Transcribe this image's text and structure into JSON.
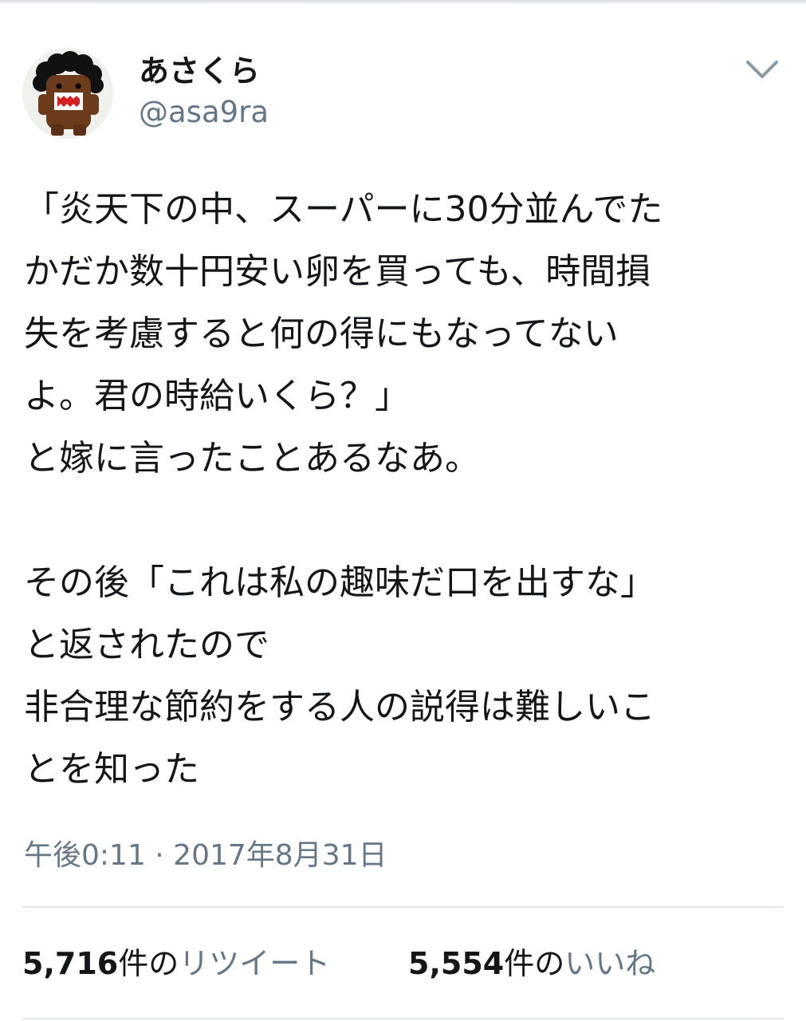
{
  "author": {
    "display_name": "あさくら",
    "handle": "@asa9ra",
    "avatar_icon": "domo-kun-avatar"
  },
  "menu": {
    "icon": "chevron-down-icon"
  },
  "tweet": {
    "lines": [
      "「炎天下の中、スーパーに30分並んでた",
      "かだか数十円安い卵を買っても、時間損",
      "失を考慮すると何の得にもなってない",
      "よ。君の時給いくら？」",
      "と嫁に言ったことあるなあ。",
      "",
      "その後「これは私の趣味だ口を出すな」",
      "と返されたので",
      "非合理な節約をする人の説得は難しいこ",
      "とを知った"
    ]
  },
  "timestamp": "午後0:11 · 2017年8月31日",
  "stats": {
    "retweets": {
      "count": "5,716",
      "unit": "件の",
      "label": "リツイート"
    },
    "likes": {
      "count": "5,554",
      "unit": "件の",
      "label": "いいね"
    }
  },
  "colors": {
    "text": "#14171a",
    "secondary": "#657786",
    "divider": "#e1e8ed"
  }
}
